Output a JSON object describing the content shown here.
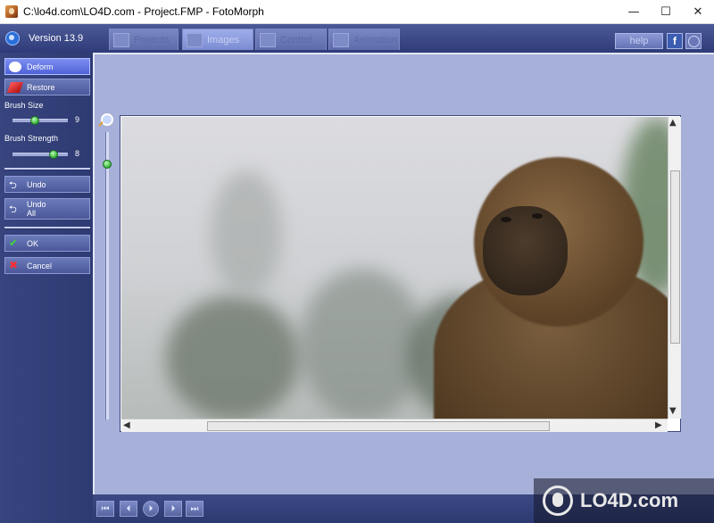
{
  "window": {
    "title": "C:\\lo4d.com\\LO4D.com - Project.FMP - FotoMorph",
    "controls": {
      "minimize": "—",
      "maximize": "☐",
      "close": "✕"
    }
  },
  "topbar": {
    "version": "Version 13.9",
    "tabs": [
      {
        "label": "Projects",
        "icon": "grid-icon"
      },
      {
        "label": "Images",
        "icon": "image-icon"
      },
      {
        "label": "Control",
        "icon": "control-icon"
      },
      {
        "label": "Animation",
        "icon": "animation-icon"
      }
    ],
    "help_label": "help",
    "facebook_label": "f"
  },
  "sidebar": {
    "deform_label": "Deform",
    "restore_label": "Restore",
    "brush_size_label": "Brush Size",
    "brush_size_value": "9",
    "brush_size_level": 0.38,
    "brush_strength_label": "Brush Strength",
    "brush_strength_value": "8",
    "brush_strength_level": 0.78,
    "undo_label": "Undo",
    "undo_all_line1": "Undo",
    "undo_all_line2": "All",
    "ok_label": "OK",
    "cancel_label": "Cancel"
  },
  "canvas": {
    "zoom_level": 0.9,
    "scroll_down_glyph": "▼",
    "scroll_up_glyph": "▲",
    "scroll_left_glyph": "◀",
    "scroll_right_glyph": "▶"
  },
  "playback": {
    "first": "⏮",
    "prev": "⏴",
    "play": "⏵",
    "next": "⏵",
    "last": "⏭"
  },
  "watermark": {
    "text": "LO4D.com"
  }
}
